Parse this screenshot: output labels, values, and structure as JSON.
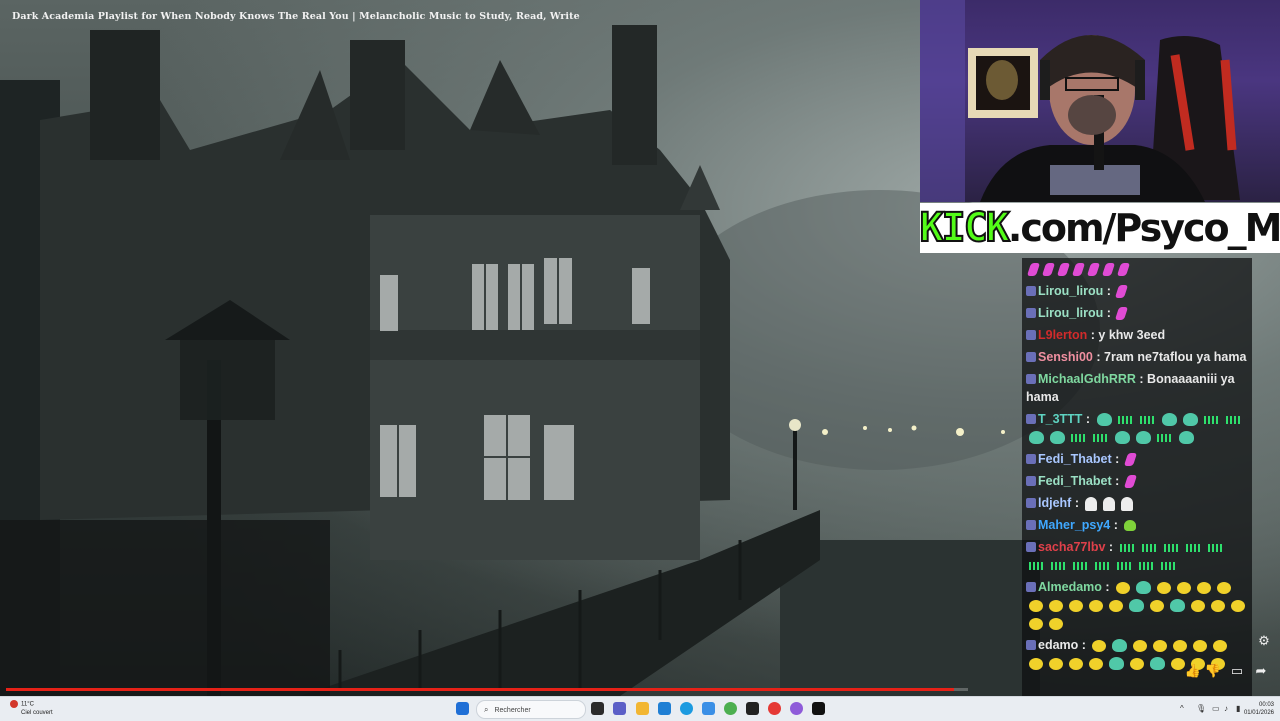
{
  "video": {
    "title": "Dark Academia Playlist for When Nobody Knows The Real You | Melancholic Music to Study, Read, Write",
    "progress": 0.985
  },
  "kick_banner": {
    "prefix": "KICK",
    "suffix": ".com/Psyco_M"
  },
  "chat": {
    "messages": [
      {
        "user": "",
        "text": "",
        "emotes": [
          "heart",
          "heart",
          "heart",
          "heart",
          "heart",
          "heart",
          "heart"
        ]
      },
      {
        "user": "Lirou_lirou",
        "color": "#9be0c4",
        "text": "",
        "emotes": [
          "heart"
        ]
      },
      {
        "user": "Lirou_lirou",
        "color": "#9be0c4",
        "text": "",
        "emotes": [
          "heart"
        ]
      },
      {
        "user": "L9lerton",
        "color": "#d12b2b",
        "text": "y khw 3eed",
        "emotes": []
      },
      {
        "user": "Senshi00",
        "color": "#ef8fa0",
        "text": "7ram ne7taflou ya hama",
        "emotes": []
      },
      {
        "user": "MichaalGdhRRR",
        "color": "#7fd8a0",
        "text": "Bonaaaaniii ya hama",
        "emotes": []
      },
      {
        "user": "T_3TTT",
        "color": "#5ed3c1",
        "text": "",
        "emotes": [
          "pepe",
          "wave",
          "wave",
          "pepe",
          "pepe",
          "wave",
          "wave",
          "pepe",
          "pepe",
          "wave",
          "wave",
          "pepe",
          "pepe",
          "wave",
          "pepe"
        ]
      },
      {
        "user": "Fedi_Thabet",
        "color": "#a9c7ff",
        "text": "",
        "emotes": [
          "heart"
        ]
      },
      {
        "user": "Fedi_Thabet",
        "color": "#9be0c4",
        "text": "",
        "emotes": [
          "heart"
        ]
      },
      {
        "user": "ldjehf",
        "color": "#a9c7ff",
        "text": "",
        "emotes": [
          "ghost",
          "ghost",
          "ghost"
        ]
      },
      {
        "user": "Maher_psy4",
        "color": "#3fa8ff",
        "text": "",
        "emotes": [
          "greenheart"
        ]
      },
      {
        "user": "sacha77lbv",
        "color": "#e0404a",
        "text": "",
        "emotes": [
          "wave",
          "wave",
          "wave",
          "wave",
          "wave",
          "wave",
          "wave",
          "wave",
          "wave",
          "wave",
          "wave",
          "wave"
        ]
      },
      {
        "user": "Almedamo",
        "color": "#7fd8a0",
        "text": "",
        "emotes": [
          "yellow",
          "pepe",
          "yellow",
          "yellow",
          "yellow",
          "yellow",
          "yellow",
          "yellow",
          "yellow",
          "yellow",
          "yellow",
          "pepe",
          "yellow",
          "pepe",
          "yellow",
          "yellow",
          "yellow",
          "yellow",
          "yellow"
        ]
      },
      {
        "user": "edamo",
        "color": "#e9e9e9",
        "text": "",
        "emotes": [
          "yellow",
          "pepe",
          "yellow",
          "yellow",
          "yellow",
          "yellow",
          "yellow",
          "yellow",
          "yellow",
          "yellow",
          "yellow",
          "pepe",
          "yellow",
          "pepe",
          "yellow",
          "yellow",
          "yellow"
        ]
      }
    ]
  },
  "taskbar": {
    "weather_temp": "11°C",
    "weather_desc": "Ciel couvert",
    "search_placeholder": "Rechercher",
    "time": "00:03",
    "date": "01/01/2026"
  }
}
